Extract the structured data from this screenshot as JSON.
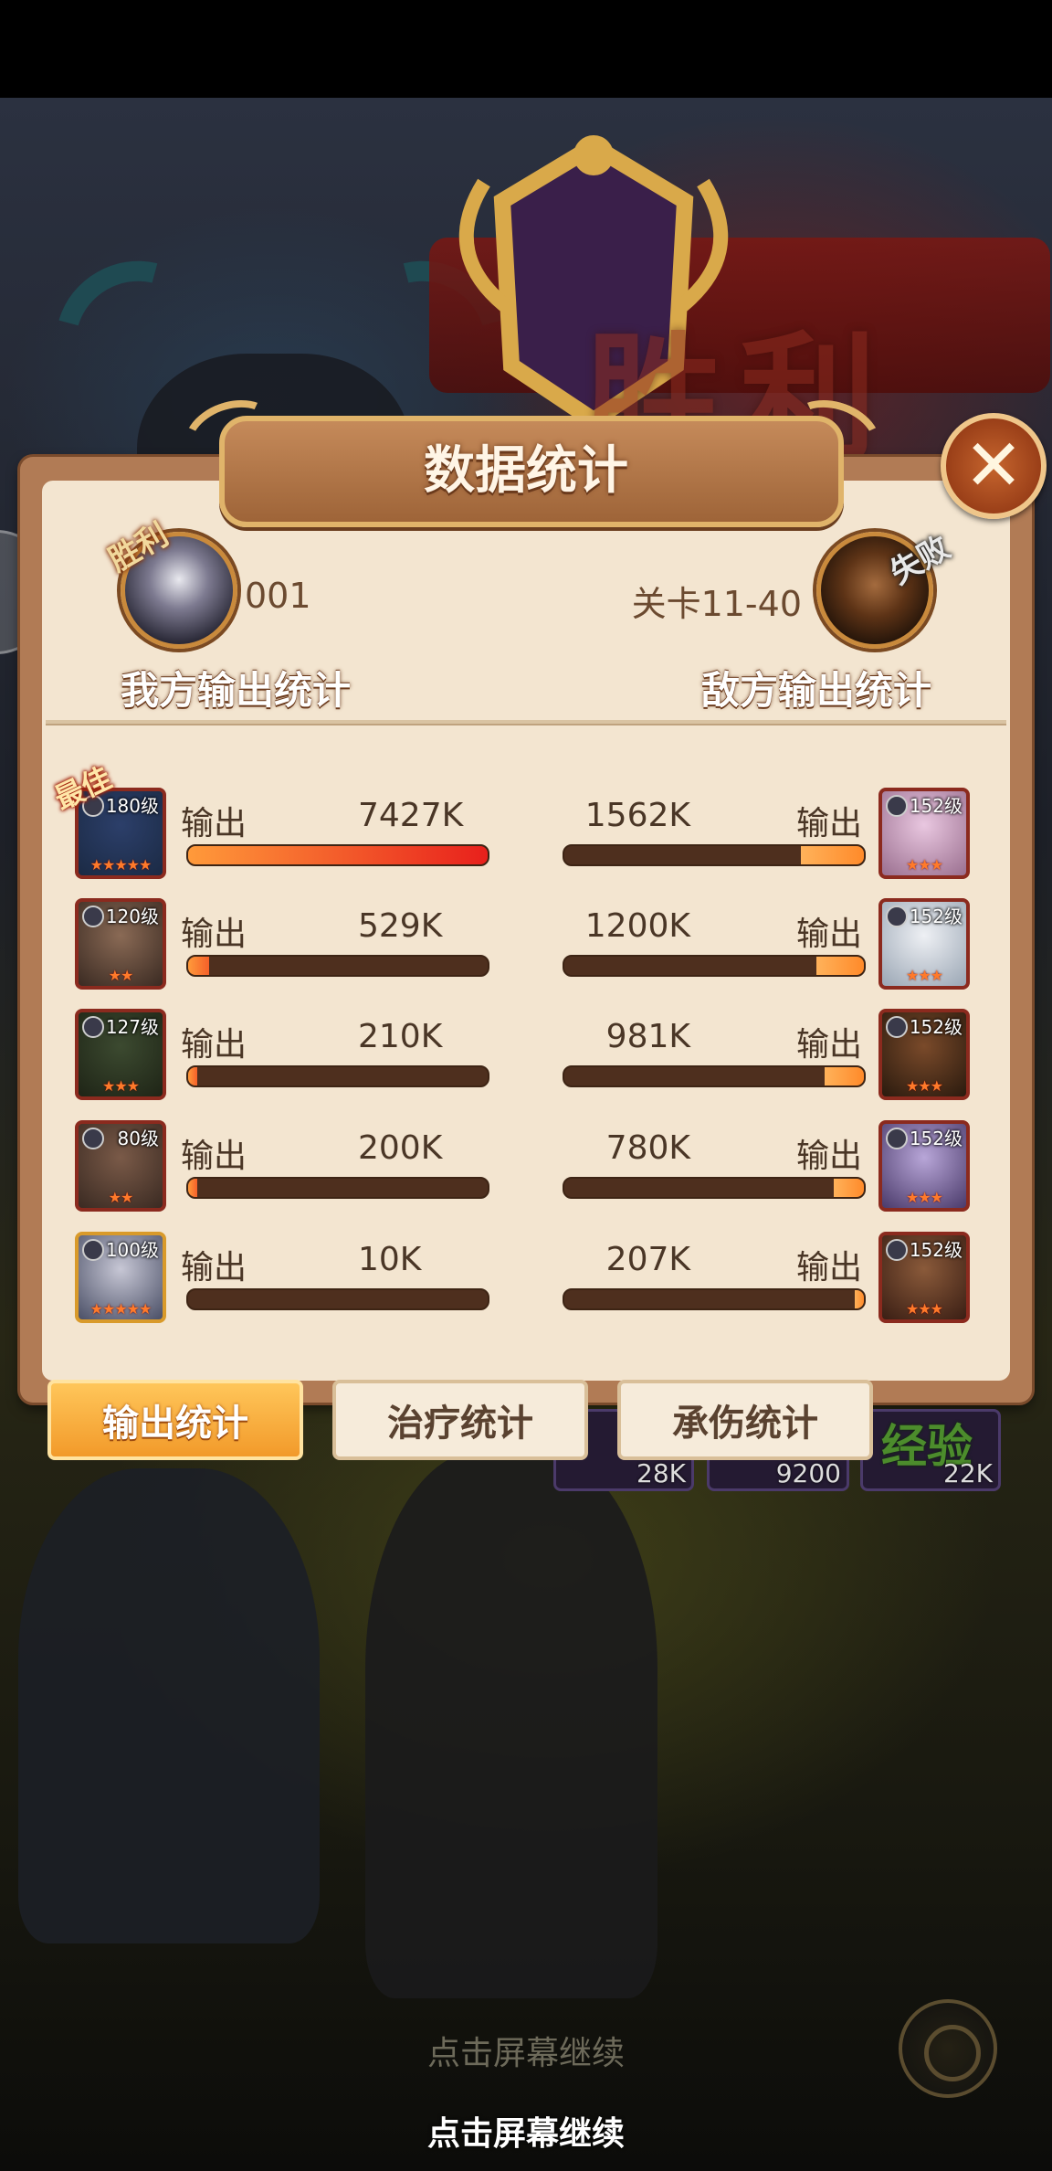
{
  "panel": {
    "title": "数据统计",
    "close_glyph": "✕",
    "ally_tag": "胜利",
    "enemy_tag": "失败",
    "player_id": "001",
    "stage": "关卡11-40",
    "ally_section": "我方输出统计",
    "enemy_section": "敌方输出统计",
    "best_tag": "最佳",
    "output_label": "输出"
  },
  "allies": [
    {
      "level": "180级",
      "value": "7427K",
      "fraction": 1.0,
      "stars": "★★★★★",
      "best": true,
      "colors": [
        "#2c3f6a",
        "#1b2a44"
      ]
    },
    {
      "level": "120级",
      "value": "529K",
      "fraction": 0.07,
      "stars": "★★",
      "best": false,
      "colors": [
        "#8a6a55",
        "#3a2a22"
      ]
    },
    {
      "level": "127级",
      "value": "210K",
      "fraction": 0.03,
      "stars": "★★★",
      "best": false,
      "colors": [
        "#3c4a30",
        "#1e2416"
      ]
    },
    {
      "level": "80级",
      "value": "200K",
      "fraction": 0.03,
      "stars": "★★",
      "best": false,
      "colors": [
        "#7a5a48",
        "#3a2a22"
      ]
    },
    {
      "level": "100级",
      "value": "10K",
      "fraction": 0.0,
      "stars": "★★★★★",
      "best": false,
      "colors": [
        "#c7c7d5",
        "#4a4f66"
      ]
    }
  ],
  "enemies": [
    {
      "level": "152级",
      "value": "1562K",
      "fraction": 0.21,
      "stars": "★★★",
      "colors": [
        "#e9c7e0",
        "#9a6f8f"
      ]
    },
    {
      "level": "152级",
      "value": "1200K",
      "fraction": 0.16,
      "stars": "★★★",
      "colors": [
        "#eef0f4",
        "#9aa6b4"
      ]
    },
    {
      "level": "152级",
      "value": "981K",
      "fraction": 0.13,
      "stars": "★★★",
      "colors": [
        "#7a4a2a",
        "#2a1a0e"
      ]
    },
    {
      "level": "152级",
      "value": "780K",
      "fraction": 0.1,
      "stars": "★★★",
      "colors": [
        "#b8a6d8",
        "#4a3a6a"
      ]
    },
    {
      "level": "152级",
      "value": "207K",
      "fraction": 0.03,
      "stars": "★★★",
      "colors": [
        "#8a5a3a",
        "#3a1e14"
      ]
    }
  ],
  "tabs": [
    {
      "label": "输出统计",
      "active": true
    },
    {
      "label": "治疗统计",
      "active": false
    },
    {
      "label": "承伤统计",
      "active": false
    }
  ],
  "rewards": [
    {
      "value": "28K"
    },
    {
      "value": "9200"
    },
    {
      "value": "22K",
      "label": "经验"
    }
  ],
  "hints": {
    "continue_dim": "点击屏幕继续",
    "continue": "点击屏幕继续"
  },
  "background": {
    "victory_text": "胜利"
  }
}
